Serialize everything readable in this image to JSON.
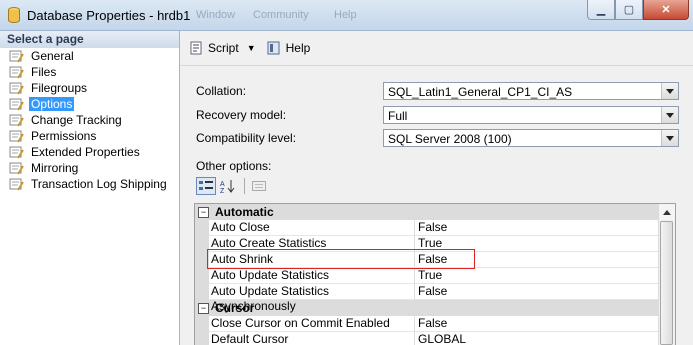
{
  "window": {
    "title": "Database Properties - hrdb1",
    "ghost_menus": [
      "Window",
      "Community",
      "Help"
    ],
    "controls": [
      "minimize",
      "maximize",
      "close"
    ]
  },
  "sidebar": {
    "header": "Select a page",
    "items": [
      {
        "label": "General"
      },
      {
        "label": "Files"
      },
      {
        "label": "Filegroups"
      },
      {
        "label": "Options",
        "selected": true
      },
      {
        "label": "Change Tracking"
      },
      {
        "label": "Permissions"
      },
      {
        "label": "Extended Properties"
      },
      {
        "label": "Mirroring"
      },
      {
        "label": "Transaction Log Shipping"
      }
    ]
  },
  "toolbar": {
    "script_label": "Script",
    "help_label": "Help"
  },
  "form": {
    "collation_label": "Collation:",
    "collation_value": "SQL_Latin1_General_CP1_CI_AS",
    "recovery_label": "Recovery model:",
    "recovery_value": "Full",
    "compat_label": "Compatibility level:",
    "compat_value": "SQL Server 2008 (100)",
    "other_options_label": "Other options:"
  },
  "grid": {
    "categories": [
      {
        "name": "Automatic",
        "rows": [
          {
            "name": "Auto Close",
            "value": "False"
          },
          {
            "name": "Auto Create Statistics",
            "value": "True"
          },
          {
            "name": "Auto Shrink",
            "value": "False"
          },
          {
            "name": "Auto Update Statistics",
            "value": "True"
          },
          {
            "name": "Auto Update Statistics Asynchronously",
            "value": "False"
          }
        ]
      },
      {
        "name": "Cursor",
        "rows": [
          {
            "name": "Close Cursor on Commit Enabled",
            "value": "False"
          },
          {
            "name": "Default Cursor",
            "value": "GLOBAL"
          }
        ]
      }
    ]
  },
  "colors": {
    "selection": "#3399ff",
    "highlight_border": "#dd2222",
    "category_bg": "#dcdcdc"
  }
}
